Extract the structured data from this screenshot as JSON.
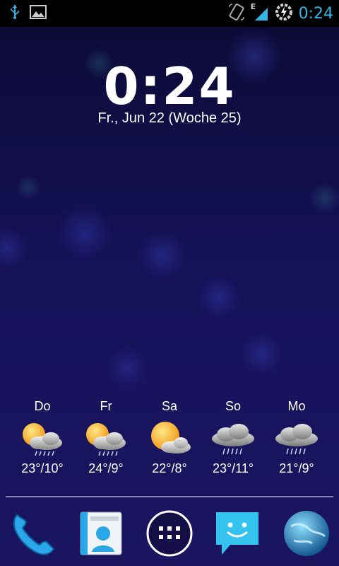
{
  "status_bar": {
    "time": "0:24",
    "network_letter": "E",
    "icons": [
      "usb-icon",
      "image-notification-icon",
      "rotate-lock-icon",
      "signal-icon",
      "battery-charging-icon"
    ]
  },
  "lockscreen": {
    "time": "0:24",
    "date": "Fr., Jun 22 (Woche 25)"
  },
  "forecast": [
    {
      "day": "Do",
      "temp": "23°/10°",
      "icon": "sun-cloud-rain-icon"
    },
    {
      "day": "Fr",
      "temp": "24°/9°",
      "icon": "sun-cloud-rain-icon"
    },
    {
      "day": "Sa",
      "temp": "22°/8°",
      "icon": "sun-cloud-icon"
    },
    {
      "day": "So",
      "temp": "23°/11°",
      "icon": "cloud-rain-icon"
    },
    {
      "day": "Mo",
      "temp": "21°/9°",
      "icon": "cloud-rain-icon"
    }
  ],
  "dock": [
    "phone-icon",
    "contacts-icon",
    "app-drawer-icon",
    "messaging-icon",
    "browser-globe-icon"
  ],
  "colors": {
    "accent": "#33b5e5",
    "background_top": "#0b0a33",
    "background_bottom": "#1b1560"
  }
}
